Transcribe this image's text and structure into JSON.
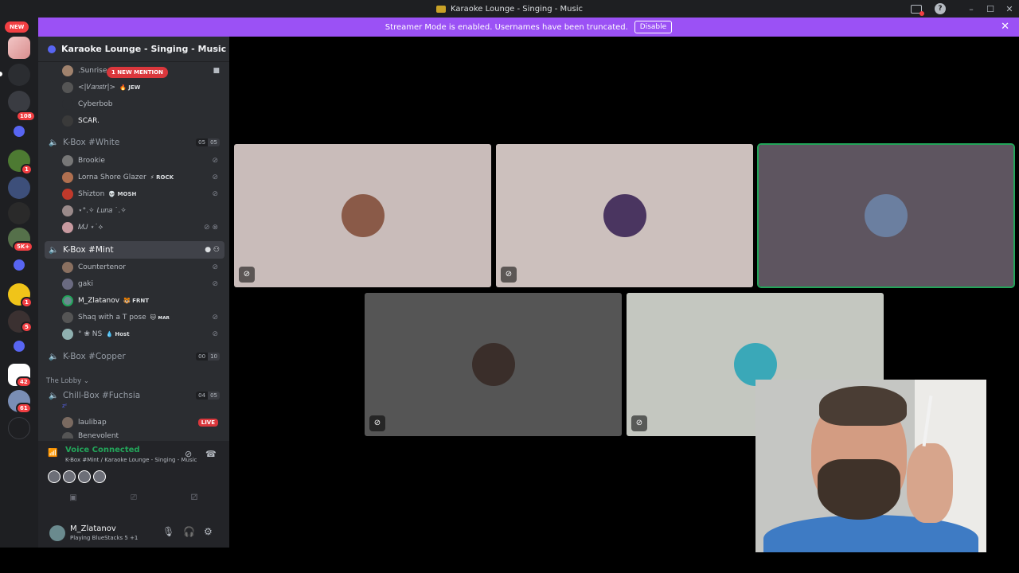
{
  "window": {
    "title": "Karaoke Lounge - Singing - Music",
    "controls": {
      "minimize": "–",
      "maximize": "☐",
      "close": "✕",
      "help": "?"
    }
  },
  "server_rail": {
    "new_label": "NEW",
    "badges": [
      "108",
      "1",
      "5K+",
      "1",
      "5",
      "42",
      "61"
    ]
  },
  "banner": {
    "text": "Streamer Mode is enabled. Usernames have been truncated.",
    "button": "Disable",
    "close": "✕"
  },
  "sidebar": {
    "guild_name": "Karaoke Lounge - Singing - Music",
    "mention_pill": "1 NEW MENTION",
    "top_members": [
      {
        "name": ".Sunrise",
        "tag": ""
      },
      {
        "name": "<|𝑉𝑎𝑛𝑠𝑡𝑟|>",
        "tag": "🔥 JEW"
      },
      {
        "name": "Cyberbob",
        "tag": ""
      },
      {
        "name": "SCAR.",
        "tag": ""
      }
    ],
    "channel_white": {
      "name": "K-Box #White",
      "count_a": "05",
      "count_b": "05"
    },
    "white_members": [
      {
        "name": "Brookie",
        "tag": ""
      },
      {
        "name": "Lorna Shore Glazer",
        "tag": "⚡ ROCK"
      },
      {
        "name": "Shizton",
        "tag": "💀 MOSH"
      },
      {
        "name": "⋆°.✧ 𝐿𝑢𝑛𝑎 ˙.✧",
        "tag": ""
      },
      {
        "name": "𝑀𝐽 ⋆˙⟡",
        "tag": ""
      }
    ],
    "channel_mint": {
      "name": "K-Box #Mint"
    },
    "mint_members": [
      {
        "name": "Countertenor",
        "tag": ""
      },
      {
        "name": "gaki",
        "tag": ""
      },
      {
        "name": "M_Zlatanov",
        "tag": "🐯 FRNT"
      },
      {
        "name": "Shaq with a T pose",
        "tag": "🐱 ᴍᴀʀ"
      },
      {
        "name": "° ❀ NS",
        "tag": "💧 Host"
      }
    ],
    "channel_copper": {
      "name": "K-Box #Copper",
      "count_a": "00",
      "count_b": "10"
    },
    "category_lobby": "The Lobby ⌄",
    "channel_fuchsia": {
      "name": "Chill-Box #Fuchsia",
      "count_a": "04",
      "count_b": "05"
    },
    "fuchsia_members": [
      {
        "name": "laulibap",
        "tag": "LIVE"
      },
      {
        "name": "Benevolent",
        "tag": ""
      }
    ]
  },
  "voice_panel": {
    "status": "Voice Connected",
    "location": "K-Box #Mint / Karaoke Lounge - Singing - Music"
  },
  "user": {
    "name": "M_Zlatanov",
    "status": "Playing BlueStacks 5 +1"
  },
  "stage": {
    "tiles": [
      {
        "bg": "#c9bcba",
        "avatar": "#8a5a48",
        "speaking": false,
        "muted": true
      },
      {
        "bg": "#ccc0bd",
        "avatar": "#4a3560",
        "speaking": false,
        "muted": true
      },
      {
        "bg": "#5e5560",
        "avatar": "#6b7fa0",
        "speaking": true,
        "muted": false
      },
      {
        "bg": "#555555",
        "avatar": "#3a2e2a",
        "speaking": false,
        "muted": true
      },
      {
        "bg": "#c4c7c0",
        "avatar": "#3aa8b8",
        "speaking": false,
        "muted": true
      }
    ]
  },
  "colors": {
    "accent": "#9b51f5",
    "online": "#23a55a",
    "danger": "#f23f43",
    "sidebar_bg": "#2b2d31"
  }
}
